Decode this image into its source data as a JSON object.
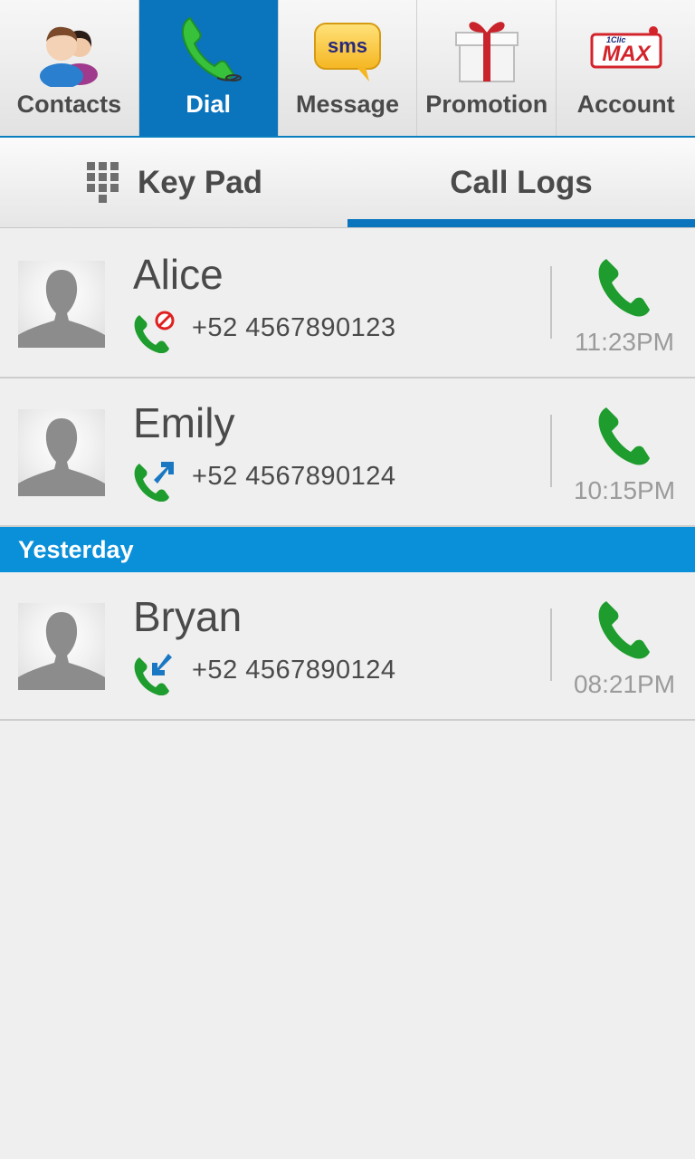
{
  "nav": {
    "items": [
      {
        "label": "Contacts",
        "icon": "contacts-icon"
      },
      {
        "label": "Dial",
        "icon": "phone-handset-icon",
        "active": true
      },
      {
        "label": "Message",
        "icon": "sms-bubble-icon",
        "icon_text": "sms"
      },
      {
        "label": "Promotion",
        "icon": "gift-box-icon"
      },
      {
        "label": "Account",
        "icon": "1clic-max-logo",
        "logo_text": "1Clic MAX"
      }
    ]
  },
  "subtabs": [
    {
      "label": "Key Pad",
      "icon": "keypad-grid-icon"
    },
    {
      "label": "Call Logs",
      "active": true
    }
  ],
  "logs": [
    {
      "name": "Alice",
      "number": "+52 4567890123",
      "time": "11:23PM",
      "status": "missed-call",
      "status_icon": "missed-call-icon"
    },
    {
      "name": "Emily",
      "number": "+52 4567890124",
      "time": "10:15PM",
      "status": "outgoing-call",
      "status_icon": "outgoing-call-icon"
    }
  ],
  "section": {
    "label": "Yesterday"
  },
  "logs_yesterday": [
    {
      "name": "Bryan",
      "number": "+52 4567890124",
      "time": "08:21PM",
      "status": "incoming-call",
      "status_icon": "incoming-call-icon"
    }
  ],
  "colors": {
    "accent": "#0a74bd",
    "section_header": "#0a8fd9",
    "call_green": "#1e9c2e",
    "missed_red": "#e02020",
    "text": "#4a4a4a",
    "time_text": "#9b9b9b"
  }
}
